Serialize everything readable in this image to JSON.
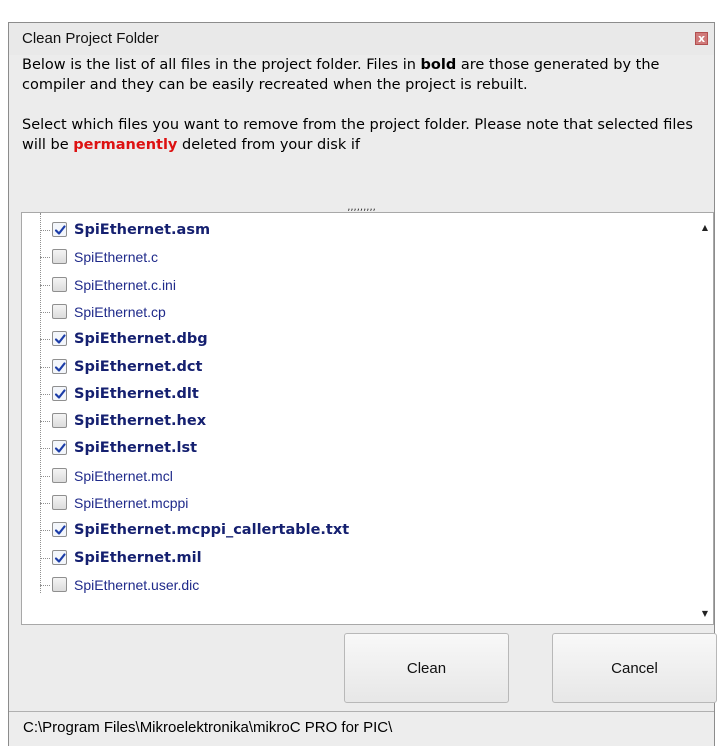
{
  "window": {
    "title": "Clean Project Folder",
    "close_glyph": "x"
  },
  "description": {
    "para1_a": "Below is the list of all files in the project folder. Files in ",
    "para1_bold": "bold",
    "para1_b": " are those generated by the compiler and they can be easily recreated when the project is rebuilt.",
    "para2_a": "Select which files you want to remove from the project folder. Please note that selected files will be ",
    "para2_red": "permanently",
    "para2_b": " deleted from your disk if"
  },
  "resize_grip": ",,,,,,,,,",
  "files": [
    {
      "name": "SpiEthernet.asm",
      "bold": true,
      "checked": true
    },
    {
      "name": "SpiEthernet.c",
      "bold": false,
      "checked": false
    },
    {
      "name": "SpiEthernet.c.ini",
      "bold": false,
      "checked": false
    },
    {
      "name": "SpiEthernet.cp",
      "bold": false,
      "checked": false
    },
    {
      "name": "SpiEthernet.dbg",
      "bold": true,
      "checked": true
    },
    {
      "name": "SpiEthernet.dct",
      "bold": true,
      "checked": true
    },
    {
      "name": "SpiEthernet.dlt",
      "bold": true,
      "checked": true
    },
    {
      "name": "SpiEthernet.hex",
      "bold": true,
      "checked": false
    },
    {
      "name": "SpiEthernet.lst",
      "bold": true,
      "checked": true
    },
    {
      "name": "SpiEthernet.mcl",
      "bold": false,
      "checked": false
    },
    {
      "name": "SpiEthernet.mcppi",
      "bold": false,
      "checked": false
    },
    {
      "name": "SpiEthernet.mcppi_callertable.txt",
      "bold": true,
      "checked": true
    },
    {
      "name": "SpiEthernet.mil",
      "bold": true,
      "checked": true
    },
    {
      "name": "SpiEthernet.user.dic",
      "bold": false,
      "checked": false
    }
  ],
  "buttons": {
    "clean": "Clean",
    "cancel": "Cancel"
  },
  "status": {
    "path": "C:\\Program Files\\Mikroelektronika\\mikroC PRO for PIC\\"
  },
  "colors": {
    "accent_red": "#dd1111",
    "file_text": "#1f2a8a",
    "check_mark": "#1c3da8"
  }
}
